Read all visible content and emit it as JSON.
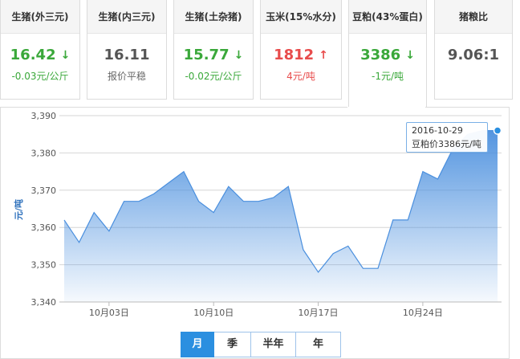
{
  "cards": [
    {
      "title": "生猪(外三元)",
      "price": "16.42",
      "arrow": "↓",
      "change": "-0.03元/公斤",
      "trend": "down"
    },
    {
      "title": "生猪(内三元)",
      "price": "16.11",
      "arrow": "",
      "change": "报价平稳",
      "trend": "flat"
    },
    {
      "title": "生猪(土杂猪)",
      "price": "15.77",
      "arrow": "↓",
      "change": "-0.02元/公斤",
      "trend": "down"
    },
    {
      "title": "玉米(15%水分)",
      "price": "1812",
      "arrow": "↑",
      "change": "4元/吨",
      "trend": "up"
    },
    {
      "title": "豆粕(43%蛋白)",
      "price": "3386",
      "arrow": "↓",
      "change": "-1元/吨",
      "trend": "down"
    },
    {
      "title": "猪粮比",
      "price": "9.06:1",
      "arrow": "",
      "change": "",
      "trend": "flat"
    }
  ],
  "tooltip": {
    "date": "2016-10-29",
    "text": "豆粕价3386元/吨"
  },
  "tabs": [
    "月",
    "季",
    "半年",
    "年"
  ],
  "active_tab": 0,
  "colors": {
    "line": "#4a8fde",
    "fill_top": "#4a8fde",
    "green": "#3aa83a",
    "red": "#e84c4c",
    "tab_active": "#2b8fe0"
  },
  "chart_data": {
    "type": "area",
    "ylabel": "元/吨",
    "ylim": [
      3340,
      3390
    ],
    "yticks": [
      "3,390",
      "3,380",
      "3,370",
      "3,360",
      "3,350",
      "3,340"
    ],
    "x": [
      "2016-09-30",
      "2016-10-01",
      "2016-10-02",
      "2016-10-03",
      "2016-10-04",
      "2016-10-05",
      "2016-10-06",
      "2016-10-07",
      "2016-10-08",
      "2016-10-09",
      "2016-10-10",
      "2016-10-11",
      "2016-10-12",
      "2016-10-13",
      "2016-10-14",
      "2016-10-15",
      "2016-10-16",
      "2016-10-17",
      "2016-10-18",
      "2016-10-19",
      "2016-10-20",
      "2016-10-21",
      "2016-10-22",
      "2016-10-23",
      "2016-10-24",
      "2016-10-25",
      "2016-10-26",
      "2016-10-27",
      "2016-10-28",
      "2016-10-29"
    ],
    "values": [
      3362,
      3356,
      3364,
      3359,
      3367,
      3367,
      3369,
      3372,
      3375,
      3367,
      3364,
      3371,
      3367,
      3367,
      3368,
      3371,
      3354,
      3348,
      3353,
      3355,
      3349,
      3349,
      3362,
      3362,
      3375,
      3373,
      3381,
      3385,
      3386,
      3386
    ],
    "xtick_labels": [
      {
        "label": "10月03日",
        "index": 3
      },
      {
        "label": "10月10日",
        "index": 10
      },
      {
        "label": "10月17日",
        "index": 17
      },
      {
        "label": "10月24日",
        "index": 24
      }
    ],
    "grid": true
  }
}
